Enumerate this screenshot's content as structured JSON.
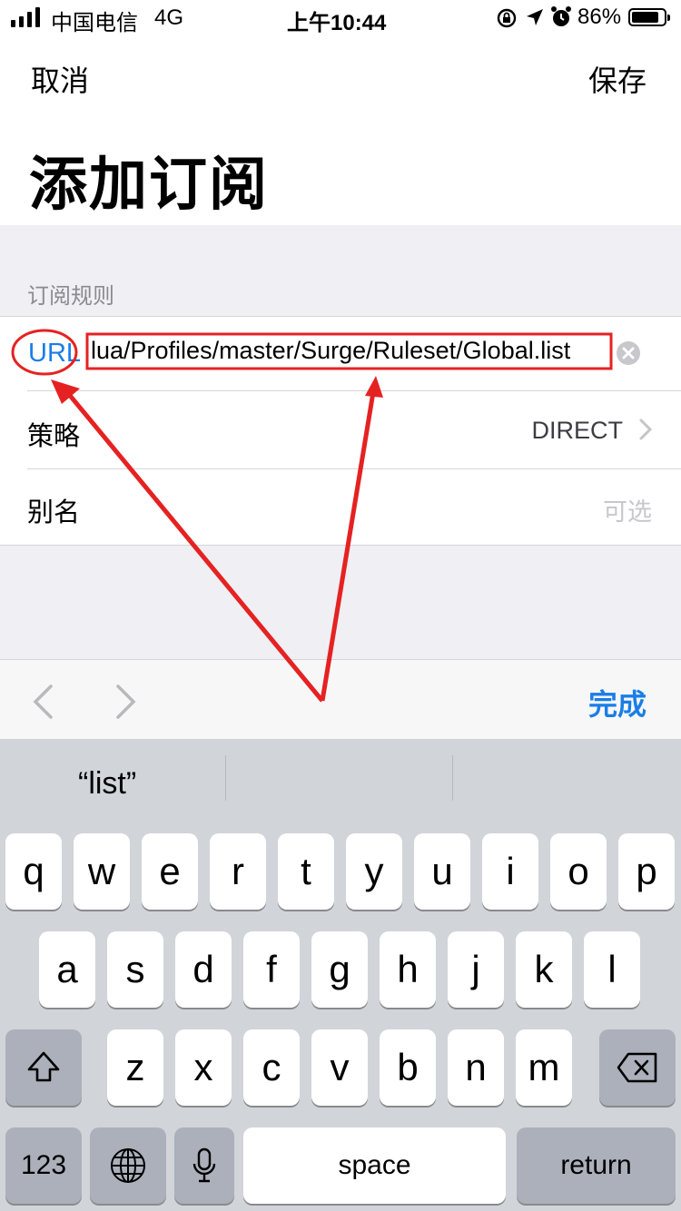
{
  "status_bar": {
    "carrier": "中国电信",
    "network": "4G",
    "time": "上午10:44",
    "battery_percent": "86%",
    "battery_level": 0.86
  },
  "nav": {
    "cancel_label": "取消",
    "save_label": "保存",
    "title": "添加订阅"
  },
  "section": {
    "header": "订阅规则",
    "url_label": "URL",
    "url_value": "lua/Profiles/master/Surge/Ruleset/Global.list",
    "policy_label": "策略",
    "policy_value": "DIRECT",
    "alias_label": "别名",
    "alias_placeholder": "可选"
  },
  "accessory": {
    "done_label": "完成"
  },
  "keyboard": {
    "suggestion": "“list”",
    "row1": [
      "q",
      "w",
      "e",
      "r",
      "t",
      "y",
      "u",
      "i",
      "o",
      "p"
    ],
    "row2": [
      "a",
      "s",
      "d",
      "f",
      "g",
      "h",
      "j",
      "k",
      "l"
    ],
    "row3": [
      "z",
      "x",
      "c",
      "v",
      "b",
      "n",
      "m"
    ],
    "numbers_label": "123",
    "space_label": "space",
    "return_label": "return"
  },
  "colors": {
    "accent": "#1a7ee6",
    "annotation": "#e52222",
    "grouped_bg": "#efeff4",
    "keyboard_bg": "#d1d4d9"
  },
  "icons": [
    "signal-icon",
    "lock-rotation-icon",
    "location-icon",
    "alarm-icon",
    "battery-icon",
    "clear-icon",
    "chevron-right-icon",
    "back-arrow-icon",
    "forward-arrow-icon",
    "shift-icon",
    "delete-icon",
    "globe-icon",
    "mic-icon",
    "annotation-arrow"
  ]
}
